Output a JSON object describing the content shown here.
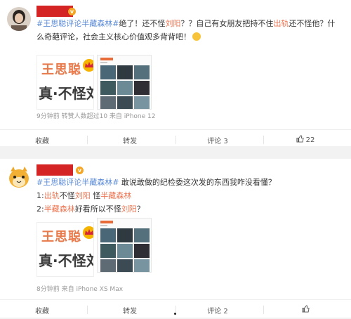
{
  "posts": [
    {
      "content": {
        "tag": "#王思聪评论半藏森林#",
        "seg1": "绝了！还不怪",
        "name1": "刘阳",
        "seg2": "？？自己有女朋友把持不住",
        "word1": "出轨",
        "seg3": "还不怪他？什么奇葩评论，社会主义核心价值观多背背吧！"
      },
      "image": {
        "name": "王思聪",
        "big": "真·不怪刘"
      },
      "meta": "9分钟前 转赞人数超过10 来自 iPhone 12",
      "actions": {
        "collect": "收藏",
        "repost": "转发",
        "comment": "评论",
        "comment_count": "3",
        "like_count": "22"
      }
    },
    {
      "content": {
        "tag": "#王思聪评论半藏森林#",
        "seg1": " 敢说敢做的纪检委这次发的东西我咋没看懂？",
        "line2_prefix": "1:",
        "l2_a": "出轨",
        "l2_b": "不怪",
        "l2_c": "刘阳",
        "l2_d": " 怪",
        "l2_e": "半藏森林",
        "line3_prefix": "2:",
        "l3_a": "半藏森林",
        "l3_b": "好看所以不怪",
        "l3_c": "刘阳",
        "l3_d": "？"
      },
      "image": {
        "name": "王思聪",
        "big": "真·不怪刘"
      },
      "meta": "8分钟前 来自 iPhone XS Max",
      "actions": {
        "collect": "收藏",
        "repost": "转发",
        "comment": "评论",
        "comment_count": "2"
      }
    }
  ]
}
